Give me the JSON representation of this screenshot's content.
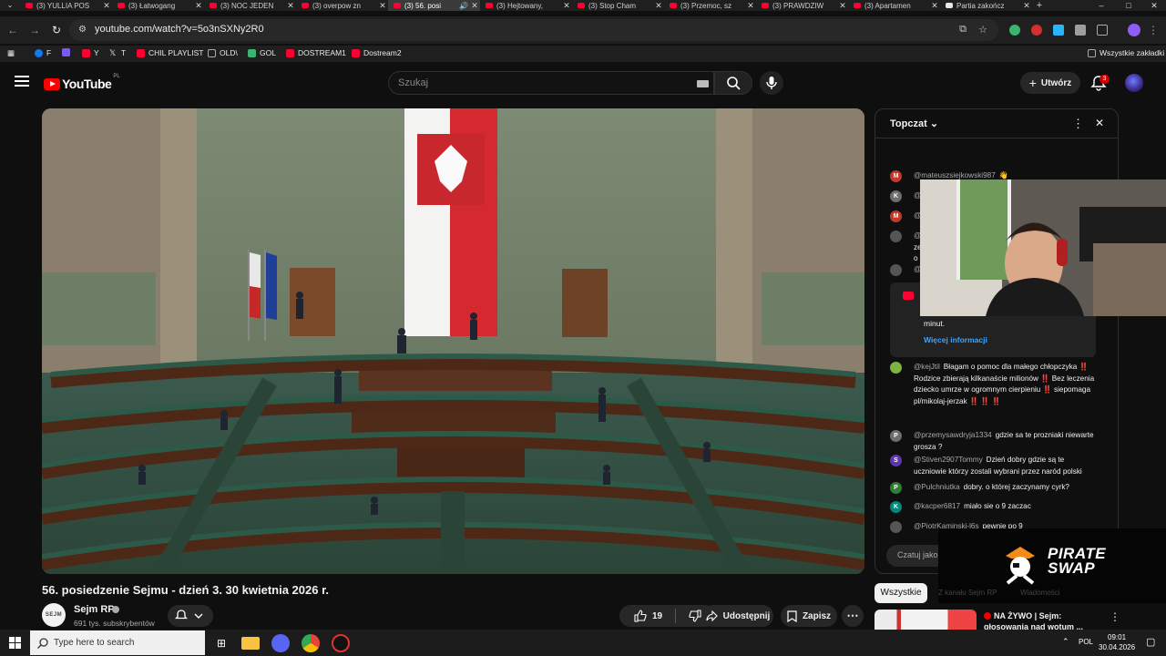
{
  "tabs": [
    {
      "title": "(3) YULLIA POS",
      "active": false
    },
    {
      "title": "(3) Łatwogang",
      "active": false
    },
    {
      "title": "(3) NOC JEDEN",
      "active": false
    },
    {
      "title": "(3) overpow zn",
      "active": false
    },
    {
      "title": "(3) 56. posi",
      "active": true
    },
    {
      "title": "(3) Hejtowany,",
      "active": false
    },
    {
      "title": "(3) Stop Cham",
      "active": false
    },
    {
      "title": "(3) Przemoc, sz",
      "active": false
    },
    {
      "title": "(3) PRAWDZIW",
      "active": false
    },
    {
      "title": "(3) Apartamen",
      "active": false
    },
    {
      "title": "Partia zakończ",
      "active": false
    }
  ],
  "window_controls": {
    "minimize": "–",
    "maximize": "□",
    "close": "✕",
    "new_tab": "+"
  },
  "address": {
    "url": "youtube.com/watch?v=5o3nSXNy2R0"
  },
  "bookmarks": {
    "items": [
      {
        "label": "F",
        "color": "#1877f2"
      },
      {
        "label": "",
        "color": "#7a5af5"
      },
      {
        "label": "Y",
        "color": "#ff0033"
      },
      {
        "label": "T",
        "color": "#e8e8e8"
      },
      {
        "label": "CHIL PLAYLIST",
        "color": "#ff0033"
      },
      {
        "label": "OLD\\",
        "color": "#888888"
      },
      {
        "label": "GOL",
        "color": "#3cb371"
      },
      {
        "label": "DOSTREAM1",
        "color": "#ff0033"
      },
      {
        "label": "Dostream2",
        "color": "#ff0033"
      }
    ],
    "all_bookmarks": "Wszystkie zakładki"
  },
  "yt": {
    "logo": "YouTube",
    "country": "PL",
    "search_placeholder": "Szukaj",
    "create_label": "Utwórz",
    "notifications": "3"
  },
  "video": {
    "title": "56. posiedzenie Sejmu - dzień 3. 30 kwietnia 2026 r.",
    "channel": "Sejm RP",
    "channel_avatar_text": "SEJM",
    "subscribers": "691 tys. subskrybentów",
    "likes": "19",
    "share_label": "Udostępnij",
    "save_label": "Zapisz"
  },
  "chat": {
    "title": "Topczat",
    "messages": [
      {
        "initial": "M",
        "color": "#c0392b",
        "author": "@mateuszsiejkowski987",
        "text": "👋"
      },
      {
        "initial": "K",
        "color": "#6d6d6d",
        "author": "@",
        "text": ""
      },
      {
        "initial": "M",
        "color": "#c0392b",
        "author": "@",
        "text": ""
      },
      {
        "initial": "",
        "color": "#555555",
        "author": "@",
        "text": "ze\no"
      },
      {
        "initial": "",
        "color": "#555555",
        "author": "@",
        "text": ""
      }
    ],
    "pinned": {
      "tail": "minut.",
      "link": "Więcej informacji"
    },
    "super": {
      "author": "@kejJtil",
      "text": "Błagam o pomoc dla małego chłopczyka ‼️ Rodzice zbierają kilkanaście milionów ‼️ Bez leczenia dziecko umrze w ogromnym cierpieniu ‼️ siepomaga pl/mikolaj-jerzak ‼️ ‼️ ‼️"
    },
    "messages2": [
      {
        "initial": "P",
        "color": "#6d6d6d",
        "author": "@przemysawdryja1334",
        "text": "gdzie sa te prozniaki niewarte grosza ?"
      },
      {
        "initial": "S",
        "color": "#5e35b1",
        "author": "@Stiven2907Tommy",
        "text": "Dzień dobry gdzie są te uczniowie którzy zostali wybrani przez naród polski"
      },
      {
        "initial": "P",
        "color": "#2e7d32",
        "author": "@Pulchniutka",
        "text": "dobry. o której zaczynamy cyrk?"
      },
      {
        "initial": "K",
        "color": "#00897b",
        "author": "@kacper6817",
        "text": "miało sie o 9 zaczac"
      },
      {
        "initial": "",
        "color": "#555555",
        "author": "@PiotrKaminski-l6s",
        "text": "pewnie po 9"
      }
    ],
    "input_placeholder": "Czatuj jako"
  },
  "overlay": {
    "brand_line1": "PIRATE",
    "brand_line2": "SWAP"
  },
  "recommendations": {
    "chip_all": "Wszystkie",
    "chip2": "Z kanału Sejm RP",
    "chip3": "Wiadomości",
    "live_title": "NA ŻYWO | Sejm: głosowania nad wotum ..."
  },
  "taskbar": {
    "search_placeholder": "Type here to search",
    "lang": "POL",
    "time": "09:01",
    "date": "30.04.2026"
  }
}
